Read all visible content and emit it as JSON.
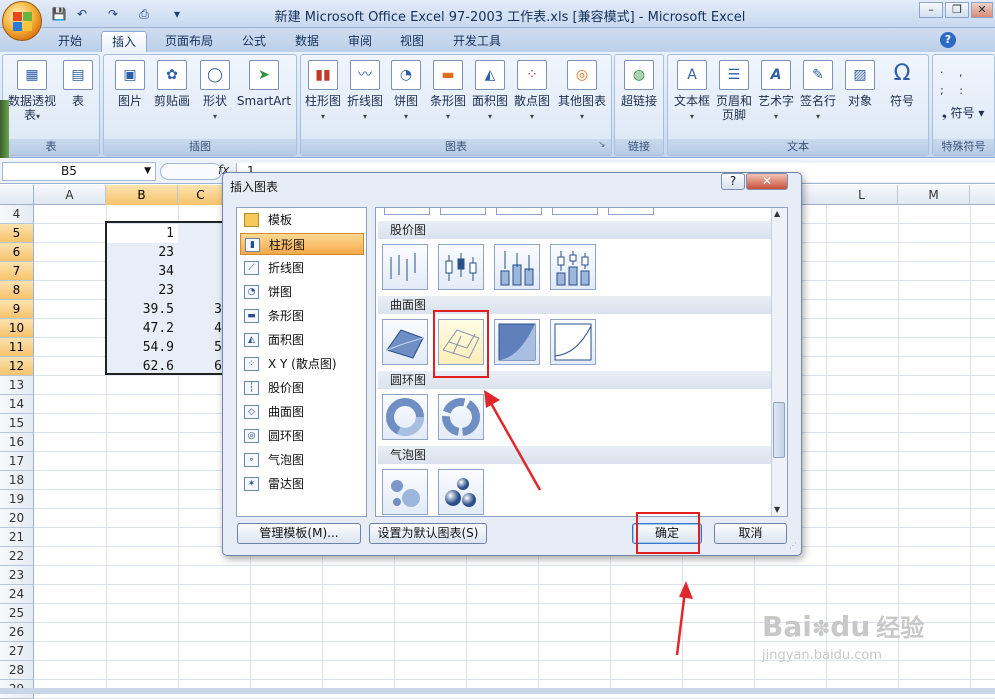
{
  "window": {
    "title": "新建 Microsoft Office Excel 97-2003 工作表.xls  [兼容模式] - Microsoft Excel",
    "minimize": "–",
    "restore": "❐",
    "close": "✕"
  },
  "qat": {
    "save": "💾",
    "undo": "↶",
    "redo": "↷",
    "print": "⎙",
    "customize": "▾"
  },
  "tabs": [
    "开始",
    "插入",
    "页面布局",
    "公式",
    "数据",
    "审阅",
    "视图",
    "开发工具"
  ],
  "help_icon": "?",
  "ribbon": {
    "groups": {
      "table": "表",
      "illustrations": "插图",
      "charts": "图表",
      "links": "链接",
      "text": "文本",
      "symbols": "特殊符号"
    },
    "buttons": {
      "pivot": "数据透视表",
      "table": "表",
      "picture": "图片",
      "clipart": "剪贴画",
      "shapes": "形状",
      "smartart": "SmartArt",
      "column": "柱形图",
      "line": "折线图",
      "pie": "饼图",
      "bar": "条形图",
      "area": "面积图",
      "scatter": "散点图",
      "other": "其他图表",
      "hyperlink": "超链接",
      "textbox": "文本框",
      "header": "页眉和页脚",
      "wordart": "艺术字",
      "signature": "签名行",
      "object": "对象",
      "symbol": "符号",
      "symbol2": "符号"
    }
  },
  "formula": {
    "namebox": "B5",
    "fx": "fx",
    "value": "1"
  },
  "columns": [
    "A",
    "B",
    "C",
    "L",
    "M"
  ],
  "rows": [
    "4",
    "5",
    "6",
    "7",
    "8",
    "9",
    "10",
    "11",
    "12",
    "13",
    "14",
    "15",
    "16",
    "17",
    "18",
    "19",
    "20",
    "21",
    "22",
    "23",
    "24",
    "25",
    "26",
    "27",
    "28",
    "29"
  ],
  "cellsB": [
    "1",
    "23",
    "34",
    "23",
    "39.5",
    "47.2",
    "54.9",
    "62.6"
  ],
  "cellsC": [
    "",
    "",
    "",
    "",
    "3",
    "4",
    "5",
    "6"
  ],
  "dialog": {
    "title": "插入图表",
    "help": "?",
    "close": "✕",
    "categories": [
      "模板",
      "柱形图",
      "折线图",
      "饼图",
      "条形图",
      "面积图",
      "X Y (散点图)",
      "股价图",
      "曲面图",
      "圆环图",
      "气泡图",
      "雷达图"
    ],
    "sections": [
      "股价图",
      "曲面图",
      "圆环图",
      "气泡图"
    ],
    "manage_templates": "管理模板(M)...",
    "set_default": "设置为默认图表(S)",
    "ok": "确定",
    "cancel": "取消"
  },
  "watermark": {
    "brand": "Bai",
    "brand2": "du",
    "cn": "经验",
    "url": "jingyan.baidu.com"
  }
}
